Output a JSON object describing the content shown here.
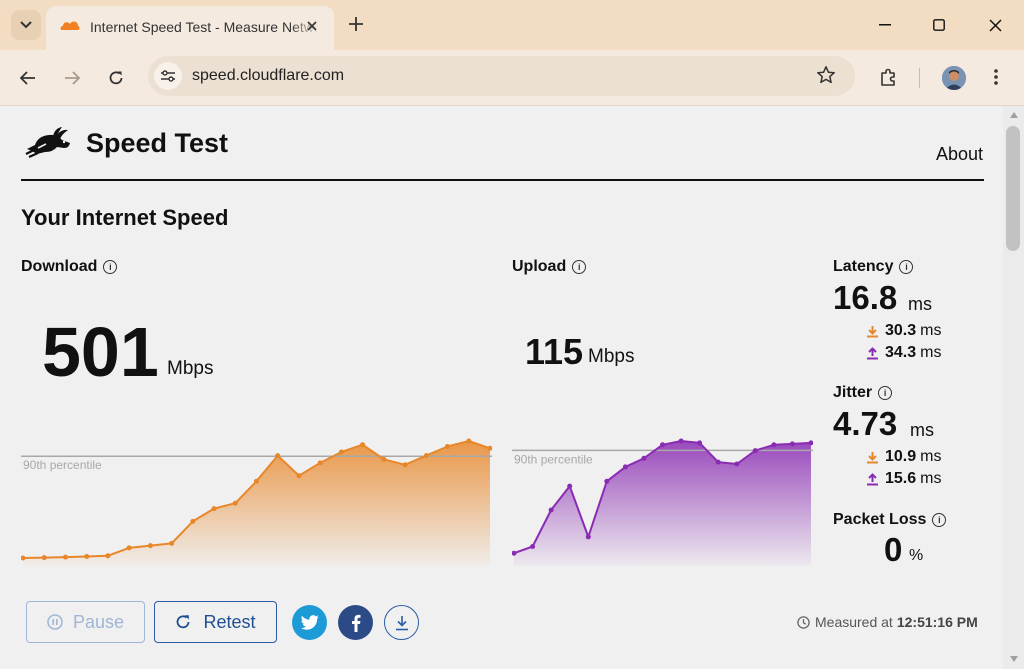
{
  "browser": {
    "tab": {
      "title": "Internet Speed Test - Measure Network Performance | Cloudflare"
    },
    "url": "speed.cloudflare.com"
  },
  "page": {
    "brand": "Speed Test",
    "about": "About",
    "section_title": "Your Internet Speed",
    "download": {
      "label": "Download",
      "value": "501",
      "unit": "Mbps",
      "color": "#e8872a"
    },
    "upload": {
      "label": "Upload",
      "value": "115",
      "unit": "Mbps",
      "color": "#8a2cb3"
    },
    "percentile_label": "90th percentile",
    "latency": {
      "label": "Latency",
      "value": "16.8",
      "unit": "ms",
      "down": "30.3",
      "up": "34.3",
      "sub_unit": "ms"
    },
    "jitter": {
      "label": "Jitter",
      "value": "4.73",
      "unit": "ms",
      "down": "10.9",
      "up": "15.6",
      "sub_unit": "ms"
    },
    "packet_loss": {
      "label": "Packet Loss",
      "value": "0",
      "unit": "%"
    },
    "buttons": {
      "pause": "Pause",
      "retest": "Retest"
    },
    "measured": {
      "prefix": "Measured at",
      "time": "12:51:16 PM"
    }
  },
  "chart_data": [
    {
      "type": "area",
      "title": "Download",
      "x": [
        0,
        1,
        2,
        3,
        4,
        5,
        6,
        7,
        8,
        9,
        10,
        11,
        12,
        13,
        14,
        15,
        16,
        17,
        18,
        19,
        20,
        21,
        22
      ],
      "values": [
        0,
        2,
        5,
        8,
        12,
        55,
        68,
        80,
        200,
        270,
        300,
        420,
        560,
        450,
        520,
        580,
        620,
        540,
        510,
        560,
        610,
        640,
        600
      ],
      "annotation": "90th percentile",
      "color": "#e8872a"
    },
    {
      "type": "area",
      "title": "Upload",
      "x": [
        0,
        1,
        2,
        3,
        4,
        5,
        6,
        7,
        8,
        9,
        10,
        11,
        12,
        13,
        14,
        15,
        16
      ],
      "values": [
        5,
        12,
        50,
        75,
        22,
        80,
        95,
        104,
        118,
        122,
        120,
        100,
        98,
        112,
        118,
        119,
        120
      ],
      "annotation": "90th percentile",
      "color": "#8a2cb3"
    }
  ]
}
